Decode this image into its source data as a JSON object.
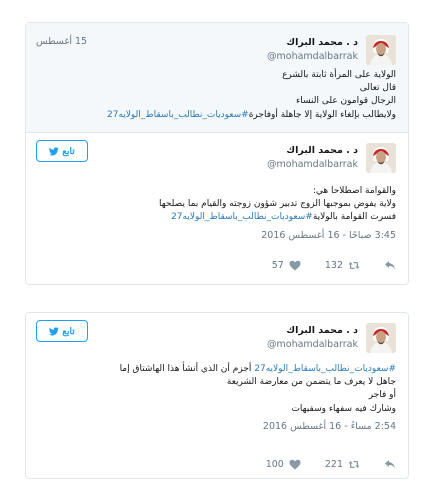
{
  "card1": {
    "quoted": {
      "display_name": "د . محمد البراك",
      "handle": "@mohamdalbarrak",
      "date": "15 أغسطس",
      "lines": [
        {
          "text": "الولاية على المرأة ثابتة بالشرع"
        },
        {
          "text": "قال تعالى"
        },
        {
          "text": "الرجال قوامون على النساء"
        },
        {
          "text": "ولايطالب بإلغاء الولاية إلا جاهلة أوفاجرة",
          "hashtag": "#سعوديات_نطالب_باسقاط_الولايه27"
        }
      ]
    },
    "tweet": {
      "display_name": "د . محمد البراك",
      "handle": "@mohamdalbarrak",
      "follow_label": "تابع",
      "lines": [
        {
          "text": "والقوامة اصطلاحا هي:"
        },
        {
          "text": "ولاية يفوض بموجبها الزوج تدبير شؤون زوجته والقيام بما يصلحها"
        },
        {
          "text": "فسرت القوامة بالولاية",
          "hashtag": "#سعوديات_نطالب_باسقاط_الولايه27"
        }
      ],
      "timestamp": "3:45 صباحًا - 16 أغسطس 2016",
      "retweets": "132",
      "likes": "57"
    }
  },
  "card2": {
    "tweet": {
      "display_name": "د . محمد البراك",
      "handle": "@mohamdalbarrak",
      "follow_label": "تابع",
      "lines": [
        {
          "hashtag": "#سعوديات_نطالب_باسقاط_الولايه27",
          "text": "أجزم أن الذي أنشأ هذا الهاشتاق إما"
        },
        {
          "text": "جاهل لا يعرف ما يتضمن من معارضة الشريعة"
        },
        {
          "text": "أو فاجر"
        },
        {
          "text": "وشارك فيه سفهاء وسفيهات"
        }
      ],
      "timestamp": "2:54 مساءً - 16 أغسطس 2016",
      "retweets": "221",
      "likes": "100"
    }
  },
  "icons": {
    "reply": "reply-icon",
    "retweet": "retweet-icon",
    "like": "heart-icon",
    "bird": "twitter-bird-icon"
  },
  "colors": {
    "link": "#2b7bb9",
    "follow": "#1da1f2",
    "muted": "#657786",
    "border": "#e1e8ed",
    "quoted_bg": "#f5f8fa"
  }
}
